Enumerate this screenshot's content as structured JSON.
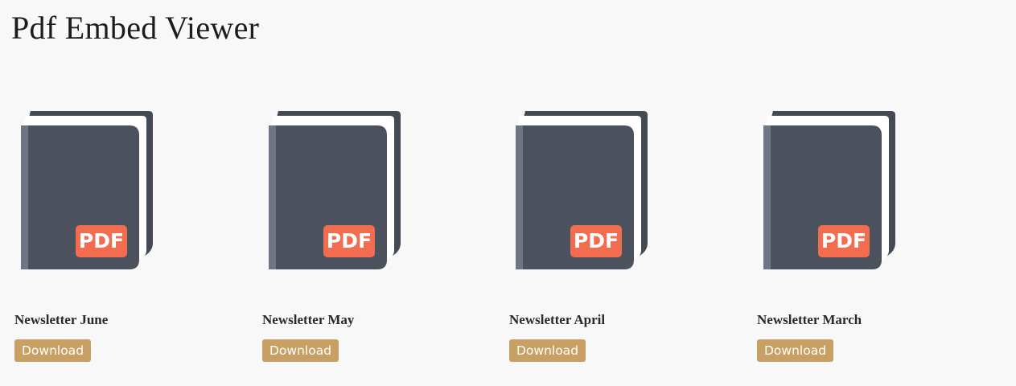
{
  "page": {
    "title": "Pdf Embed Viewer"
  },
  "colors": {
    "background": "#f8f8f8",
    "book_cover": "#4b515d",
    "book_spine": "#6e7583",
    "book_pages": "#ffffff",
    "book_outline": "#434a54",
    "pdf_badge": "#f26d50",
    "download_button": "#c8a063"
  },
  "icons": {
    "thumbnail": "pdf-book-icon"
  },
  "documents": [
    {
      "title": "Newsletter June",
      "badge": "PDF",
      "download_label": "Download"
    },
    {
      "title": "Newsletter May",
      "badge": "PDF",
      "download_label": "Download"
    },
    {
      "title": "Newsletter April",
      "badge": "PDF",
      "download_label": "Download"
    },
    {
      "title": "Newsletter March",
      "badge": "PDF",
      "download_label": "Download"
    }
  ]
}
